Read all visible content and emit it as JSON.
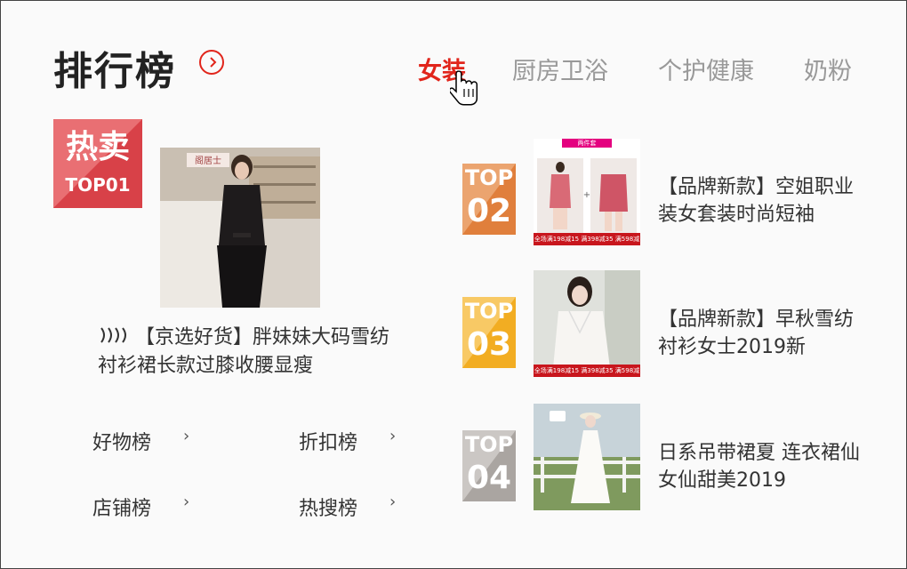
{
  "header": {
    "title": "排行榜",
    "tabs": [
      {
        "label": "女装",
        "active": true
      },
      {
        "label": "厨房卫浴",
        "active": false
      },
      {
        "label": "个护健康",
        "active": false
      },
      {
        "label": "奶粉",
        "active": false
      }
    ]
  },
  "hot": {
    "badge_title": "热卖",
    "badge_rank": "TOP01",
    "store_sign": "阁居士",
    "description": "【京选好货】胖妹妹大码雪纺衬衫裙长款过膝收腰显瘦"
  },
  "sublinks": [
    {
      "label": "好物榜",
      "chevron": "›"
    },
    {
      "label": "折扣榜",
      "chevron": "›"
    },
    {
      "label": "店铺榜",
      "chevron": "›"
    },
    {
      "label": "热搜榜",
      "chevron": "›"
    }
  ],
  "ranks": [
    {
      "label": "TOP",
      "num": "02",
      "color": "#e88f53",
      "desc": "【品牌新款】空姐职业装女套装时尚短袖",
      "tag": "两件套",
      "strip": "全场满198减15 满398减35 满598减58"
    },
    {
      "label": "TOP",
      "num": "03",
      "color": "#f6ba3c",
      "desc": "【品牌新款】早秋雪纺衬衫女士2019新",
      "tag": "",
      "strip": "全场满198减15 满398减35 满598减58"
    },
    {
      "label": "TOP",
      "num": "04",
      "color": "#c1bcb8",
      "desc": "日系吊带裙夏 连衣裙仙女仙甜美2019",
      "tag": "",
      "strip": ""
    }
  ],
  "colors": {
    "accent": "#e1251b",
    "hot_badge": "#e05a5f"
  },
  "icons": {
    "title_arrow": "chevron-right-circle-icon",
    "cursor": "hand-pointer-icon",
    "sound": "sound-wave-icon"
  }
}
